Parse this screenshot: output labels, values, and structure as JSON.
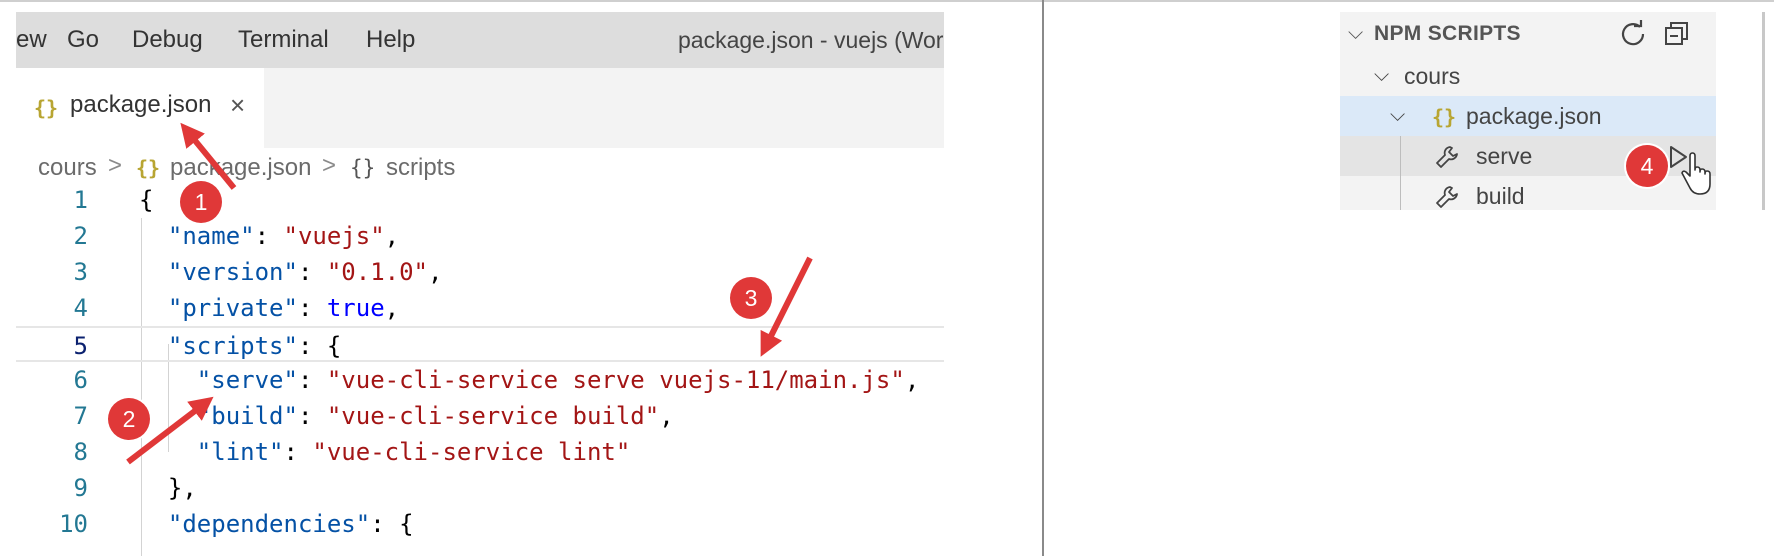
{
  "menubar": {
    "items": [
      "ew",
      "Go",
      "Debug",
      "Terminal",
      "Help"
    ],
    "window_title": "package.json - vuejs (Wor"
  },
  "tab": {
    "icon": "{}",
    "label": "package.json",
    "close": "×"
  },
  "breadcrumb": {
    "folder": "cours",
    "file_icon": "{}",
    "file": "package.json",
    "symbol_icon": "{}",
    "symbol": "scripts",
    "separator": ">"
  },
  "code": {
    "line_numbers": [
      "1",
      "2",
      "3",
      "4",
      "5",
      "6",
      "7",
      "8",
      "9",
      "10"
    ],
    "lines": [
      {
        "tokens": [
          {
            "t": "p",
            "v": "{"
          }
        ]
      },
      {
        "tokens": [
          {
            "t": "p",
            "v": "  "
          },
          {
            "t": "k",
            "v": "\"name\""
          },
          {
            "t": "p",
            "v": ": "
          },
          {
            "t": "s",
            "v": "\"vuejs\""
          },
          {
            "t": "p",
            "v": ","
          }
        ]
      },
      {
        "tokens": [
          {
            "t": "p",
            "v": "  "
          },
          {
            "t": "k",
            "v": "\"version\""
          },
          {
            "t": "p",
            "v": ": "
          },
          {
            "t": "s",
            "v": "\"0.1.0\""
          },
          {
            "t": "p",
            "v": ","
          }
        ]
      },
      {
        "tokens": [
          {
            "t": "p",
            "v": "  "
          },
          {
            "t": "k",
            "v": "\"private\""
          },
          {
            "t": "p",
            "v": ": "
          },
          {
            "t": "b",
            "v": "true"
          },
          {
            "t": "p",
            "v": ","
          }
        ]
      },
      {
        "tokens": [
          {
            "t": "p",
            "v": "  "
          },
          {
            "t": "k",
            "v": "\"scripts\""
          },
          {
            "t": "p",
            "v": ": {"
          }
        ]
      },
      {
        "tokens": [
          {
            "t": "p",
            "v": "    "
          },
          {
            "t": "k",
            "v": "\"serve\""
          },
          {
            "t": "p",
            "v": ": "
          },
          {
            "t": "s",
            "v": "\"vue-cli-service serve vuejs-11/main.js\""
          },
          {
            "t": "p",
            "v": ","
          }
        ]
      },
      {
        "tokens": [
          {
            "t": "p",
            "v": "    "
          },
          {
            "t": "k",
            "v": "\"build\""
          },
          {
            "t": "p",
            "v": ": "
          },
          {
            "t": "s",
            "v": "\"vue-cli-service build\""
          },
          {
            "t": "p",
            "v": ","
          }
        ]
      },
      {
        "tokens": [
          {
            "t": "p",
            "v": "    "
          },
          {
            "t": "k",
            "v": "\"lint\""
          },
          {
            "t": "p",
            "v": ": "
          },
          {
            "t": "s",
            "v": "\"vue-cli-service lint\""
          }
        ]
      },
      {
        "tokens": [
          {
            "t": "p",
            "v": "  },"
          }
        ]
      },
      {
        "tokens": [
          {
            "t": "p",
            "v": "  "
          },
          {
            "t": "k",
            "v": "\"dependencies\""
          },
          {
            "t": "p",
            "v": ": {"
          }
        ]
      }
    ]
  },
  "npm_scripts": {
    "title": "NPM SCRIPTS",
    "folder": "cours",
    "file_icon": "{}",
    "file": "package.json",
    "scripts": [
      "serve",
      "build"
    ],
    "icons": [
      "refresh-icon",
      "collapse-all-icon",
      "wrench-icon",
      "play-icon"
    ]
  },
  "annotations": {
    "badges": [
      "1",
      "2",
      "3",
      "4"
    ],
    "color": "#e03838"
  },
  "colors": {
    "key": "#0451a5",
    "string": "#a31515",
    "keyword": "#0000ff",
    "line_number": "#237893",
    "selection": "#dbe9f8"
  }
}
